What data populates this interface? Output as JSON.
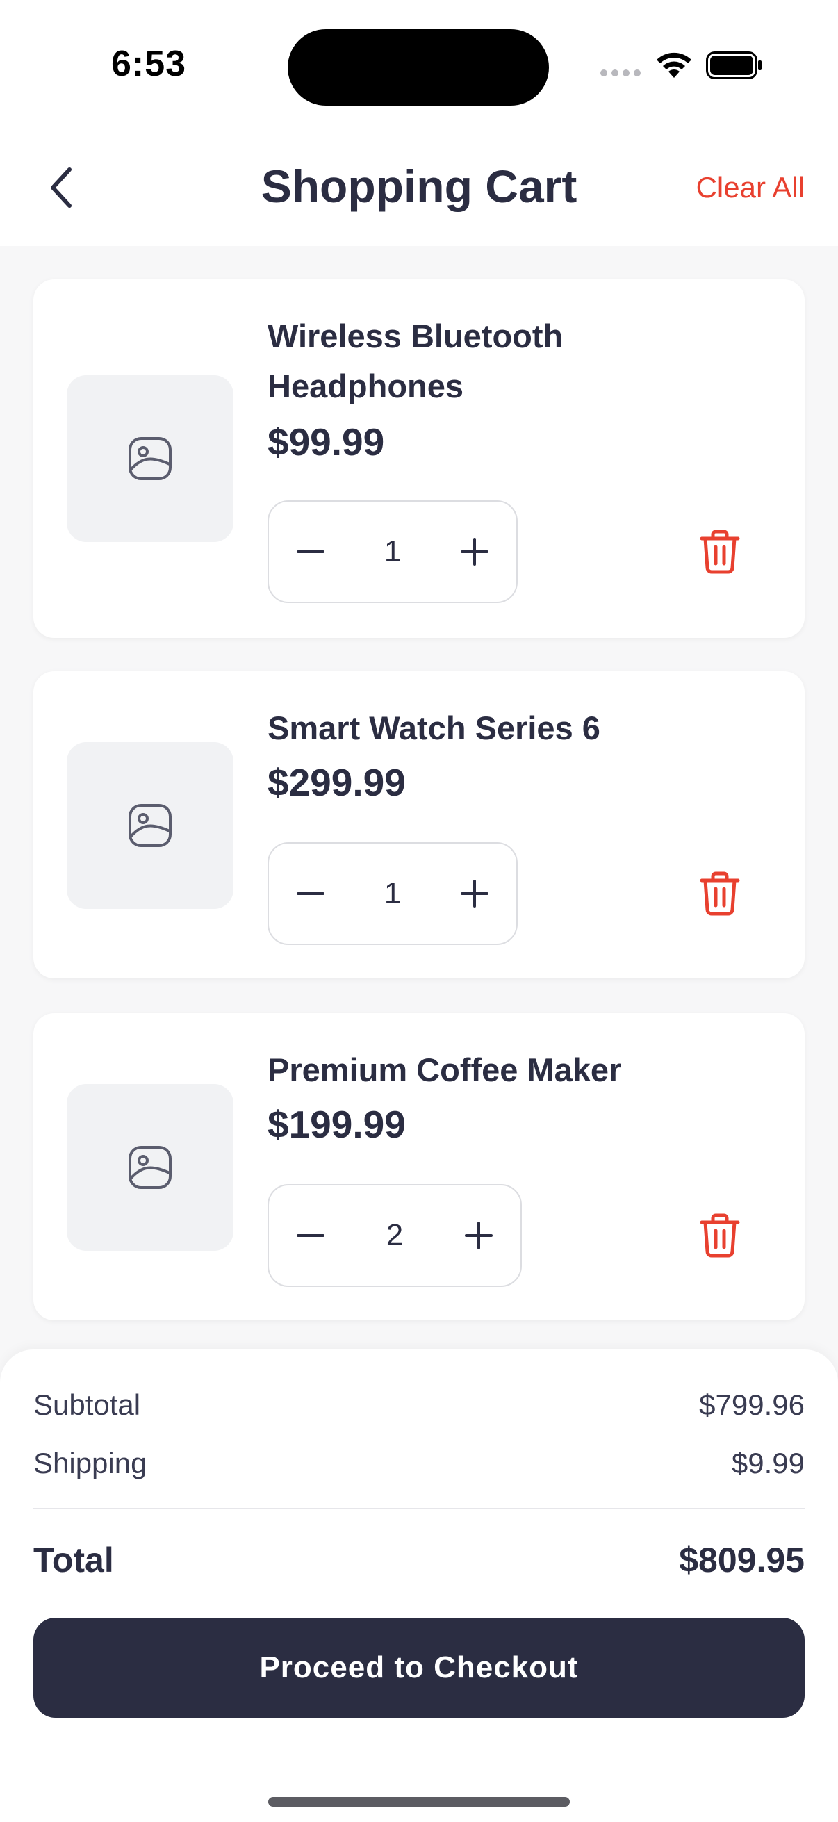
{
  "status_bar": {
    "time": "6:53"
  },
  "header": {
    "title": "Shopping Cart",
    "clear_label": "Clear All"
  },
  "cart": {
    "items": [
      {
        "name": "Wireless Bluetooth Headphones",
        "price": "$99.99",
        "quantity": "1"
      },
      {
        "name": "Smart Watch Series 6",
        "price": "$299.99",
        "quantity": "1"
      },
      {
        "name": "Premium Coffee Maker",
        "price": "$199.99",
        "quantity": "2"
      }
    ]
  },
  "summary": {
    "subtotal_label": "Subtotal",
    "subtotal_value": "$799.96",
    "shipping_label": "Shipping",
    "shipping_value": "$9.99",
    "total_label": "Total",
    "total_value": "$809.95",
    "checkout_label": "Proceed to Checkout"
  },
  "colors": {
    "accent": "#e8402f",
    "primary": "#2b2d42",
    "background": "#f7f7f8"
  },
  "icons": {
    "back": "chevron-left-icon",
    "thumbnail": "image-placeholder-icon",
    "minus": "minus-icon",
    "plus": "plus-icon",
    "delete": "trash-icon"
  }
}
